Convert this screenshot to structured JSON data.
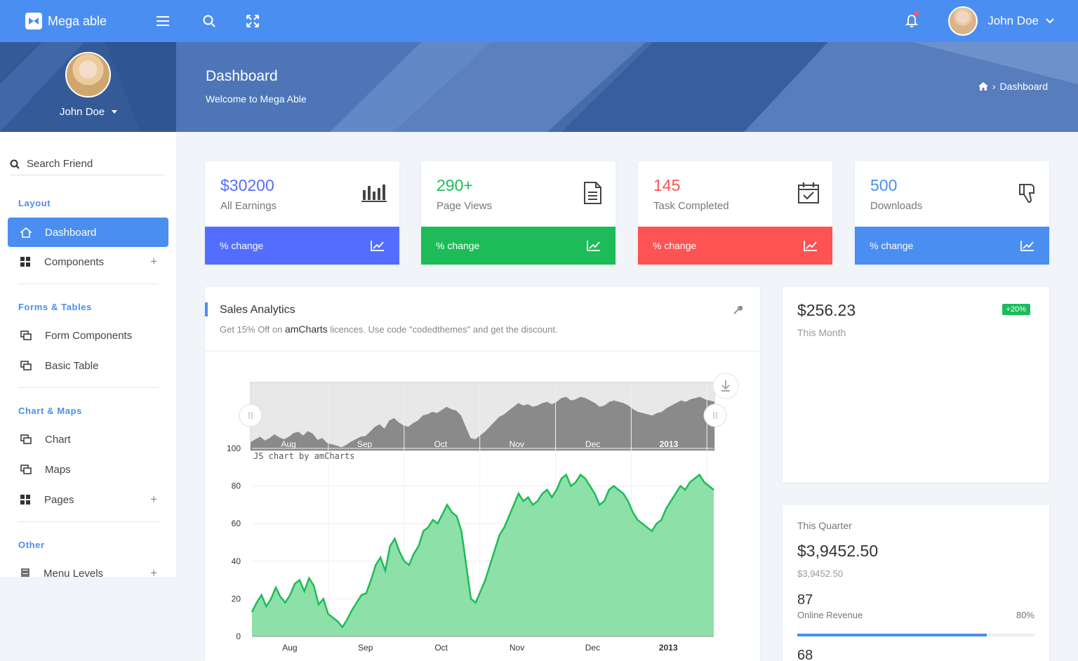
{
  "app": {
    "name": "Mega able"
  },
  "topbar": {
    "user_name": "John Doe"
  },
  "header": {
    "title": "Dashboard",
    "subtitle": "Welcome to Mega Able",
    "breadcrumb": "Dashboard"
  },
  "profile": {
    "name": "John Doe"
  },
  "sidebar": {
    "search_placeholder": "Search Friend",
    "sections": {
      "layout": "Layout",
      "forms": "Forms & Tables",
      "charts": "Chart & Maps",
      "other": "Other"
    },
    "items": {
      "dashboard": "Dashboard",
      "components": "Components",
      "form_components": "Form Components",
      "basic_table": "Basic Table",
      "chart": "Chart",
      "maps": "Maps",
      "pages": "Pages",
      "menu_levels": "Menu Levels"
    }
  },
  "stats": [
    {
      "value": "$30200",
      "label": "All Earnings",
      "footer": "% change",
      "color": "#536dfe",
      "accent": "#536dfe"
    },
    {
      "value": "290+",
      "label": "Page Views",
      "footer": "% change",
      "color": "#1dbc58",
      "accent": "#1dbc58"
    },
    {
      "value": "145",
      "label": "Task Completed",
      "footer": "% change",
      "color": "#ff5252",
      "accent": "#ff5252"
    },
    {
      "value": "500",
      "label": "Downloads",
      "footer": "% change",
      "color": "#4a8ef1",
      "accent": "#4a8ef1"
    }
  ],
  "sales": {
    "title": "Sales Analytics",
    "desc_prefix": "Get 15% Off on ",
    "desc_brand": "amCharts",
    "desc_suffix": " licences. Use code \"codedthemes\" and get the discount.",
    "credit": "JS chart by amCharts"
  },
  "month": {
    "value": "$256.23",
    "label": "This Month",
    "badge": "+20%"
  },
  "quarter": {
    "label": "This Quarter",
    "value": "$3,9452.50",
    "sub": "$3,9452.50",
    "n1": "87",
    "rev_label": "Online Revenue",
    "rev_pct": "80%",
    "rev_fraction": 0.8,
    "n2": "68"
  },
  "chart_data": {
    "type": "area",
    "x_labels": [
      "Aug",
      "Sep",
      "Oct",
      "Nov",
      "Dec",
      "2013"
    ],
    "y_ticks": [
      0,
      20,
      40,
      60,
      80,
      100
    ],
    "ylim": [
      0,
      100
    ],
    "series": [
      {
        "values": [
          13,
          18,
          22,
          16,
          20,
          26,
          21,
          18,
          22,
          28,
          30,
          24,
          31,
          27,
          17,
          20,
          12,
          10,
          8,
          5,
          9,
          14,
          18,
          22,
          23,
          30,
          38,
          42,
          35,
          48,
          52,
          45,
          40,
          38,
          44,
          48,
          56,
          58,
          62,
          60,
          65,
          70,
          66,
          64,
          56,
          38,
          20,
          18,
          24,
          30,
          38,
          46,
          54,
          58,
          64,
          70,
          76,
          72,
          74,
          70,
          72,
          76,
          78,
          74,
          78,
          84,
          86,
          80,
          82,
          86,
          84,
          80,
          76,
          70,
          72,
          78,
          80,
          78,
          76,
          72,
          66,
          62,
          60,
          58,
          56,
          60,
          62,
          68,
          72,
          76,
          80,
          78,
          82,
          84,
          86,
          82,
          80,
          78
        ]
      }
    ],
    "color": "#1dbc58",
    "fill": "#8de0a8"
  }
}
